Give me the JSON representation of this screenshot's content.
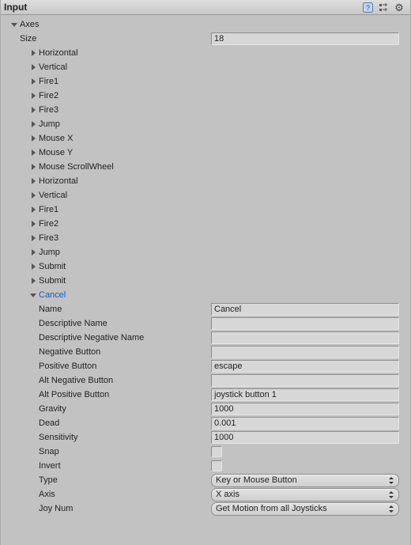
{
  "header": {
    "title": "Input"
  },
  "axes": {
    "label": "Axes",
    "size_label": "Size",
    "size_value": "18",
    "items": [
      "Horizontal",
      "Vertical",
      "Fire1",
      "Fire2",
      "Fire3",
      "Jump",
      "Mouse X",
      "Mouse Y",
      "Mouse ScrollWheel",
      "Horizontal",
      "Vertical",
      "Fire1",
      "Fire2",
      "Fire3",
      "Jump",
      "Submit",
      "Submit",
      "Cancel"
    ]
  },
  "selected": {
    "label": "Cancel",
    "fields": {
      "name": {
        "label": "Name",
        "value": "Cancel"
      },
      "descName": {
        "label": "Descriptive Name",
        "value": ""
      },
      "descNeg": {
        "label": "Descriptive Negative Name",
        "value": ""
      },
      "negBtn": {
        "label": "Negative Button",
        "value": ""
      },
      "posBtn": {
        "label": "Positive Button",
        "value": "escape"
      },
      "altNeg": {
        "label": "Alt Negative Button",
        "value": ""
      },
      "altPos": {
        "label": "Alt Positive Button",
        "value": "joystick button 1"
      },
      "gravity": {
        "label": "Gravity",
        "value": "1000"
      },
      "dead": {
        "label": "Dead",
        "value": "0.001"
      },
      "sensitivity": {
        "label": "Sensitivity",
        "value": "1000"
      },
      "snap": {
        "label": "Snap"
      },
      "invert": {
        "label": "Invert"
      },
      "type": {
        "label": "Type",
        "value": "Key or Mouse Button"
      },
      "axis": {
        "label": "Axis",
        "value": "X axis"
      },
      "joy": {
        "label": "Joy Num",
        "value": "Get Motion from all Joysticks"
      }
    }
  }
}
